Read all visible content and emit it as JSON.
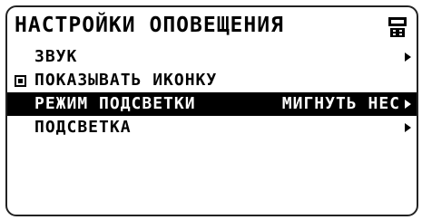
{
  "header": {
    "title": "НАСТРОЙКИ ОПОВЕЩЕНИЯ",
    "icon": "phone-icon"
  },
  "menu": {
    "items": [
      {
        "label": "ЗВУК",
        "value": "",
        "has_arrow": true,
        "selected": false
      },
      {
        "label": "ПОКАЗЫВАТЬ ИКОНКУ",
        "value": "",
        "has_checkbox": true,
        "checked": true,
        "selected": false
      },
      {
        "label": "РЕЖИМ ПОДСВЕТКИ",
        "value": "МИГНУТЬ НЕС",
        "has_arrow": true,
        "selected": true
      },
      {
        "label": "ПОДСВЕТКА",
        "value": "",
        "has_arrow": true,
        "selected": false
      }
    ]
  },
  "colors": {
    "foreground": "#000000",
    "background": "#ffffff",
    "highlight": "#000000"
  }
}
